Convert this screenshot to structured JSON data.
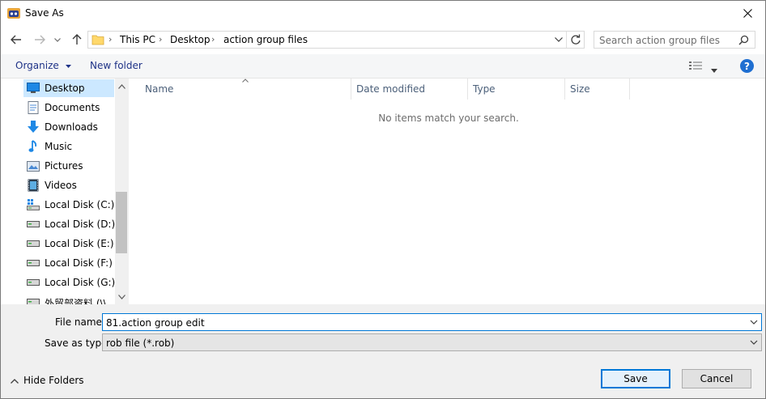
{
  "window": {
    "title": "Save As"
  },
  "address": {
    "crumbs": [
      "This PC",
      "Desktop",
      "action group files"
    ],
    "search_placeholder": "Search action group files"
  },
  "toolbar": {
    "organize": "Organize",
    "new_folder": "New folder",
    "help": "?"
  },
  "nav": {
    "items": [
      {
        "label": "Desktop",
        "icon": "desktop-icon",
        "selected": true
      },
      {
        "label": "Documents",
        "icon": "documents-icon"
      },
      {
        "label": "Downloads",
        "icon": "downloads-icon"
      },
      {
        "label": "Music",
        "icon": "music-icon"
      },
      {
        "label": "Pictures",
        "icon": "pictures-icon"
      },
      {
        "label": "Videos",
        "icon": "videos-icon"
      },
      {
        "label": "Local Disk (C:)",
        "icon": "system-drive-icon"
      },
      {
        "label": "Local Disk (D:)",
        "icon": "drive-icon"
      },
      {
        "label": "Local Disk (E:)",
        "icon": "drive-icon"
      },
      {
        "label": "Local Disk (F:)",
        "icon": "drive-icon"
      },
      {
        "label": "Local Disk (G:)",
        "icon": "drive-icon"
      },
      {
        "label": "外贸部资料 (\\\\",
        "icon": "network-drive-icon"
      }
    ]
  },
  "columns": [
    "Name",
    "Date modified",
    "Type",
    "Size"
  ],
  "empty_message": "No items match your search.",
  "form": {
    "file_name_label": "File name:",
    "file_name_value": "81.action group edit",
    "type_label": "Save as type:",
    "type_value": "rob file (*.rob)"
  },
  "buttons": {
    "save": "Save",
    "cancel": "Cancel",
    "hide_folders": "Hide Folders"
  },
  "colors": {
    "accent": "#0078d7",
    "selected_bg": "#cce8ff",
    "link": "#1e3287"
  }
}
